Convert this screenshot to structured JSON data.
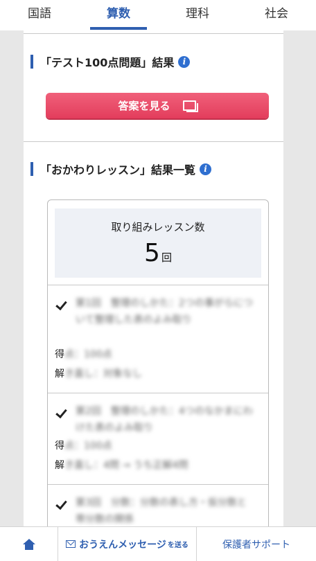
{
  "tabs": [
    {
      "label": "国語",
      "active": false
    },
    {
      "label": "算数",
      "active": true
    },
    {
      "label": "理科",
      "active": false
    },
    {
      "label": "社会",
      "active": false
    }
  ],
  "test_section": {
    "title": "「テスト100点問題」結果",
    "button_label": "答案を見る"
  },
  "lesson_section": {
    "title": "「おかわりレッスン」結果一覧",
    "count_label": "取り組みレッスン数",
    "count_value": "5",
    "count_unit": "回",
    "lessons": [
      {
        "title": "第1回　整理のしかた：2つの事がらについて整理した表のよみ取り",
        "score_first": "得",
        "score_rest": "点：100点",
        "retry_first": "解",
        "retry_rest": "き直し：対象なし"
      },
      {
        "title": "第2回　整理のしかた：4つのなかまにわけた表のよみ取り",
        "score_first": "得",
        "score_rest": "点：100点",
        "retry_first": "解",
        "retry_rest": "き直し：4問 → うち正解4問"
      },
      {
        "title": "第3回　分数：分数の表し方・仮分数と帯分数の関係",
        "score_first": "",
        "score_rest": "",
        "retry_first": "",
        "retry_rest": ""
      }
    ]
  },
  "bottom_nav": {
    "message_label": "おうえんメッセージ",
    "message_suffix": "を送る",
    "support_label": "保護者サポート"
  },
  "colors": {
    "accent": "#2f5fb0",
    "button": "#e94a66",
    "count_bg": "#eef1f6"
  },
  "icons": [
    "info-icon",
    "document-icon",
    "check-icon",
    "home-icon",
    "mail-icon"
  ]
}
